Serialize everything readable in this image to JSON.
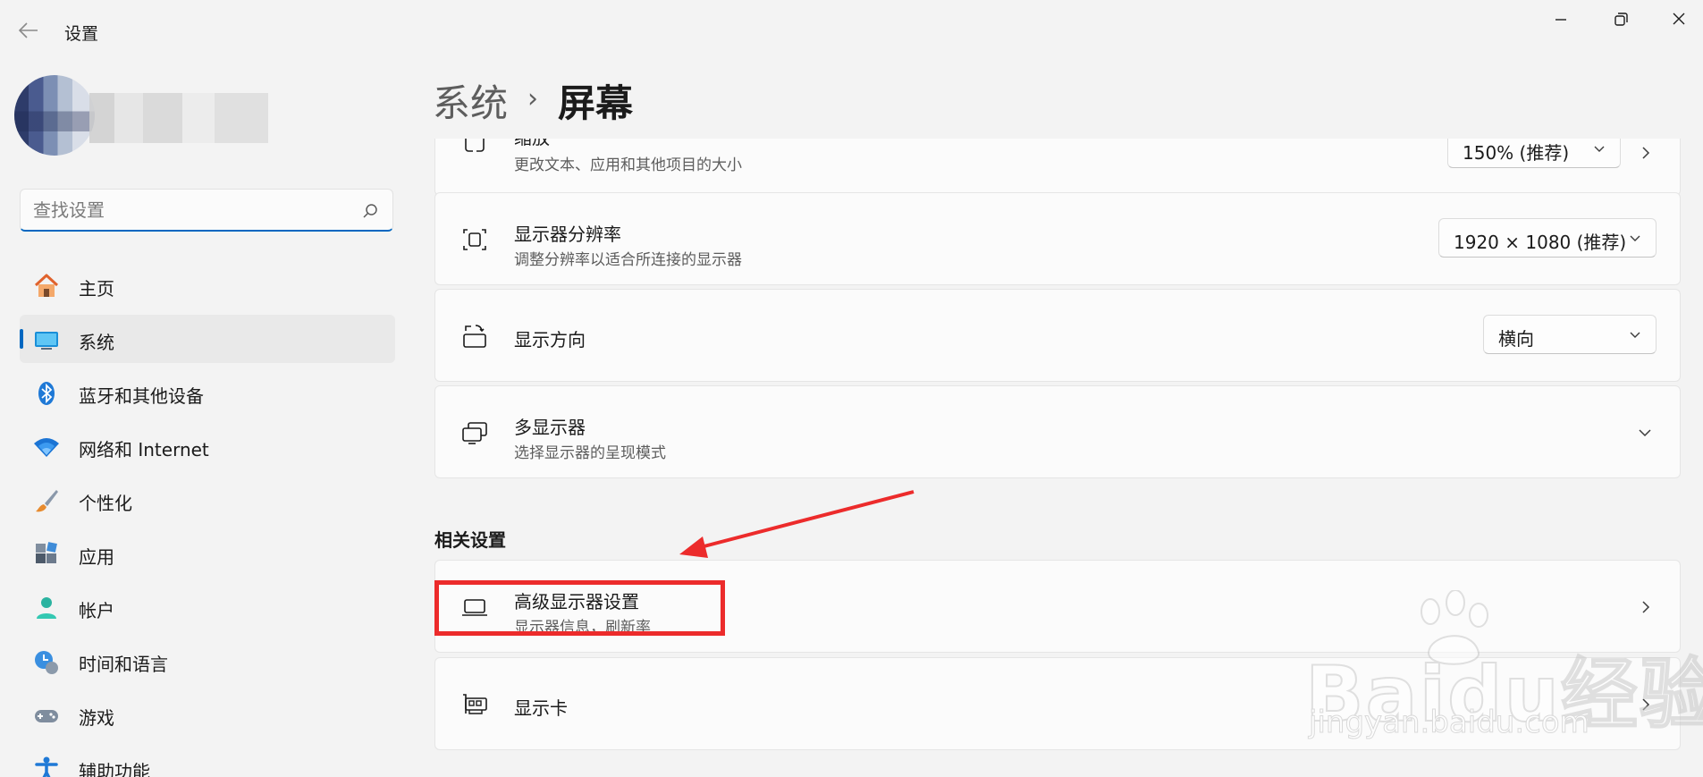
{
  "window": {
    "title": "设置",
    "controls": [
      "minimize-icon",
      "restore-icon",
      "close-icon"
    ]
  },
  "search": {
    "placeholder": "查找设置"
  },
  "sidebar": {
    "items": [
      {
        "label": "主页",
        "icon": "home-icon"
      },
      {
        "label": "系统",
        "icon": "system-display-icon",
        "active": true
      },
      {
        "label": "蓝牙和其他设备",
        "icon": "bluetooth-icon"
      },
      {
        "label": "网络和 Internet",
        "icon": "wifi-icon"
      },
      {
        "label": "个性化",
        "icon": "paintbrush-icon"
      },
      {
        "label": "应用",
        "icon": "apps-icon"
      },
      {
        "label": "帐户",
        "icon": "account-icon"
      },
      {
        "label": "时间和语言",
        "icon": "clock-globe-icon"
      },
      {
        "label": "游戏",
        "icon": "gamepad-icon"
      },
      {
        "label": "辅助功能",
        "icon": "accessibility-icon"
      }
    ]
  },
  "header": {
    "parent": "系统",
    "separator": "›",
    "current": "屏幕"
  },
  "settings": {
    "scale": {
      "title": "缩放",
      "subtitle": "更改文本、应用和其他项目的大小",
      "value": "150% (推荐)"
    },
    "resolution": {
      "title": "显示器分辨率",
      "subtitle": "调整分辨率以适合所连接的显示器",
      "value": "1920 × 1080 (推荐)"
    },
    "orientation": {
      "title": "显示方向",
      "value": "横向"
    },
    "multi_display": {
      "title": "多显示器",
      "subtitle": "选择显示器的呈现模式"
    }
  },
  "related": {
    "label": "相关设置",
    "advanced": {
      "title": "高级显示器设置",
      "subtitle": "显示器信息，刷新率"
    },
    "graphics": {
      "title": "显示卡"
    }
  },
  "watermark": {
    "brand": "Baidu经验",
    "url": "jingyan.baidu.com"
  },
  "colors": {
    "accent": "#0067c0",
    "annotation": "#ec2b2b",
    "background": "#f3f3f3",
    "card": "#fbfbfb"
  }
}
